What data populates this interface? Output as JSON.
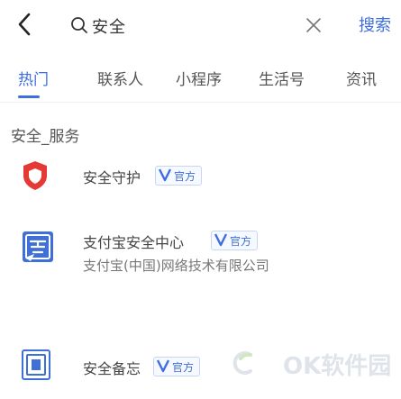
{
  "header": {
    "search_query": "安全",
    "search_label": "搜索"
  },
  "tabs": [
    {
      "label": "热门",
      "active": true
    },
    {
      "label": "联系人",
      "active": false
    },
    {
      "label": "小程序",
      "active": false
    },
    {
      "label": "生活号",
      "active": false
    },
    {
      "label": "资讯",
      "active": false
    }
  ],
  "section": {
    "title": "安全_服务"
  },
  "results": [
    {
      "name": "安全守护",
      "badge": "官方",
      "icon": "shield-icon"
    },
    {
      "name": "支付宝安全中心",
      "badge": "官方",
      "subtitle": "支付宝(中国)网络技术有限公司",
      "icon": "security-center-icon"
    },
    {
      "name": "安全备忘",
      "badge": "官方",
      "icon": "memo-icon"
    }
  ],
  "watermark": "OK软件园",
  "colors": {
    "accent": "#3d6ee0",
    "shield_red": "#e53935",
    "mini_blue": "#3f6fd8"
  }
}
